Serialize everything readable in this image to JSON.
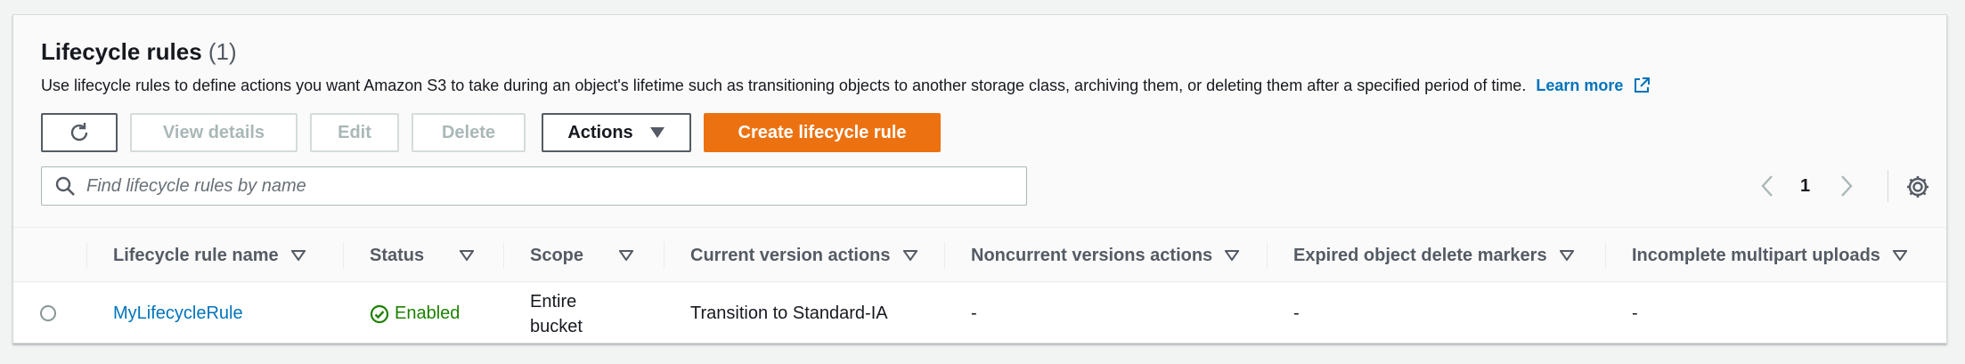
{
  "header": {
    "title": "Lifecycle rules",
    "count": "(1)",
    "description": "Use lifecycle rules to define actions you want Amazon S3 to take during an object's lifetime such as transitioning objects to another storage class, archiving them, or deleting them after a specified period of time.",
    "learn_more": "Learn more"
  },
  "toolbar": {
    "view_details": "View details",
    "edit": "Edit",
    "delete": "Delete",
    "actions": "Actions",
    "create": "Create lifecycle rule"
  },
  "search": {
    "placeholder": "Find lifecycle rules by name"
  },
  "pagination": {
    "current_page": "1"
  },
  "table": {
    "columns": [
      "Lifecycle rule name",
      "Status",
      "Scope",
      "Current version actions",
      "Noncurrent versions actions",
      "Expired object delete markers",
      "Incomplete multipart uploads"
    ],
    "rows": [
      {
        "name": "MyLifecycleRule",
        "status": "Enabled",
        "scope_line1": "Entire",
        "scope_line2": "bucket",
        "current_version_actions": "Transition to Standard-IA",
        "noncurrent_versions_actions": "-",
        "expired_object_delete_markers": "-",
        "incomplete_multipart_uploads": "-"
      }
    ]
  },
  "colors": {
    "primary": "#ec7211",
    "link": "#0073bb",
    "success": "#1d8102"
  },
  "icons": [
    "refresh-icon",
    "external-link-icon",
    "caret-down-icon",
    "search-icon",
    "chevron-left-icon",
    "chevron-right-icon",
    "settings-gear-icon",
    "sort-caret-icon",
    "check-circle-icon"
  ]
}
